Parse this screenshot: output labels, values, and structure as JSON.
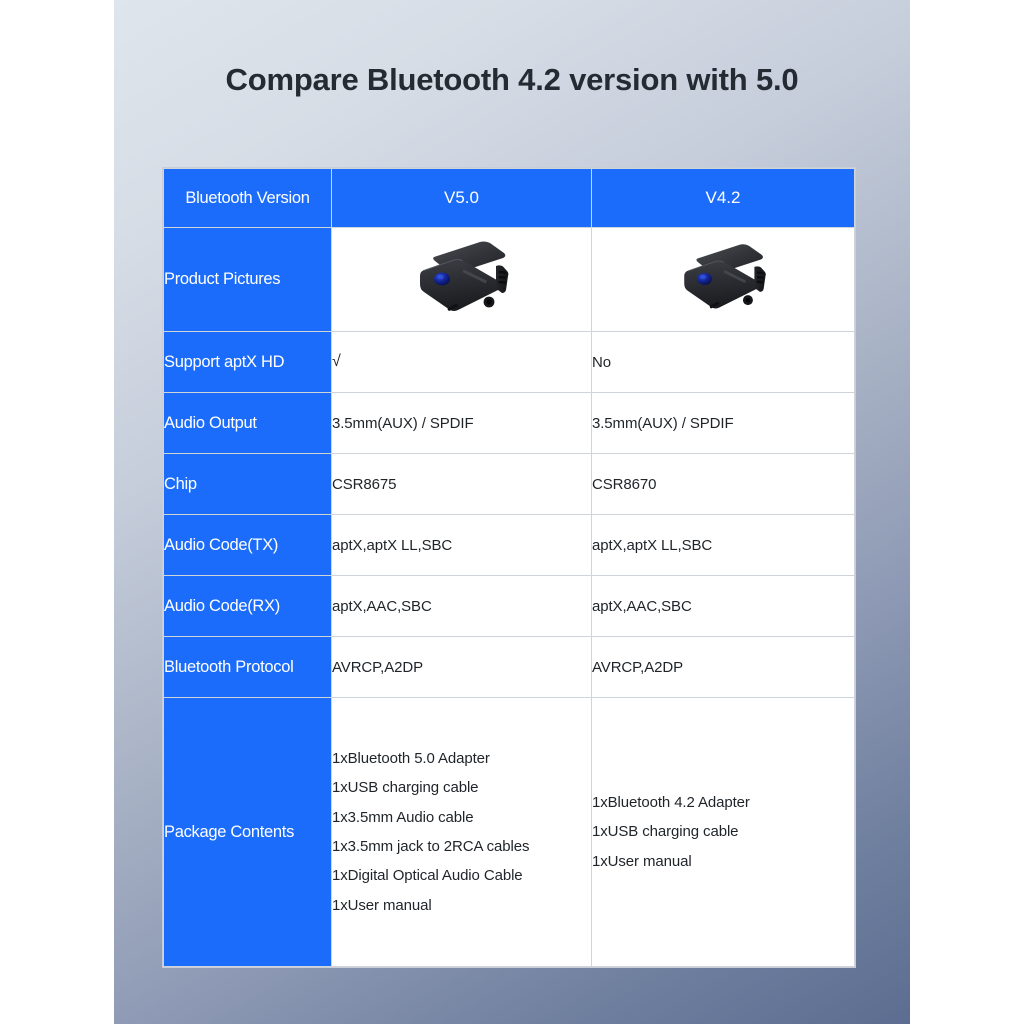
{
  "page": {
    "title": "Compare Bluetooth 4.2 version with 5.0",
    "accent_blue": "#1c6cfb",
    "text_dark": "#1f2429",
    "background_top": "#dfe5ec",
    "background_bottom": "#5c6d91"
  },
  "table": {
    "header": {
      "label": "Bluetooth Version",
      "col_v50": "V5.0",
      "col_v42": "V4.2"
    },
    "rows": [
      {
        "label": "Product Pictures",
        "type": "image",
        "v50": "bluetooth-adapter-v50-image",
        "v42": "bluetooth-adapter-v42-image"
      },
      {
        "label": "Support aptX HD",
        "type": "text",
        "v50": "√",
        "v42": "No"
      },
      {
        "label": "Audio Output",
        "type": "text",
        "v50": "3.5mm(AUX) / SPDIF",
        "v42": "3.5mm(AUX) / SPDIF"
      },
      {
        "label": "Chip",
        "type": "text",
        "v50": "CSR8675",
        "v42": "CSR8670"
      },
      {
        "label": "Audio Code(TX)",
        "type": "text",
        "v50": "aptX,aptX LL,SBC",
        "v42": "aptX,aptX LL,SBC"
      },
      {
        "label": "Audio Code(RX)",
        "type": "text",
        "v50": "aptX,AAC,SBC",
        "v42": "aptX,AAC,SBC"
      },
      {
        "label": "Bluetooth Protocol",
        "type": "text",
        "v50": "AVRCP,A2DP",
        "v42": "AVRCP,A2DP"
      }
    ],
    "package": {
      "label": "Package Contents",
      "v50_items": [
        "1xBluetooth 5.0 Adapter",
        "1xUSB charging cable",
        "1x3.5mm Audio cable",
        "1x3.5mm jack to 2RCA cables",
        "1xDigital Optical Audio Cable",
        "1xUser manual"
      ],
      "v42_items": [
        "1xBluetooth 4.2 Adapter",
        "1xUSB charging cable",
        "1xUser manual"
      ]
    }
  }
}
